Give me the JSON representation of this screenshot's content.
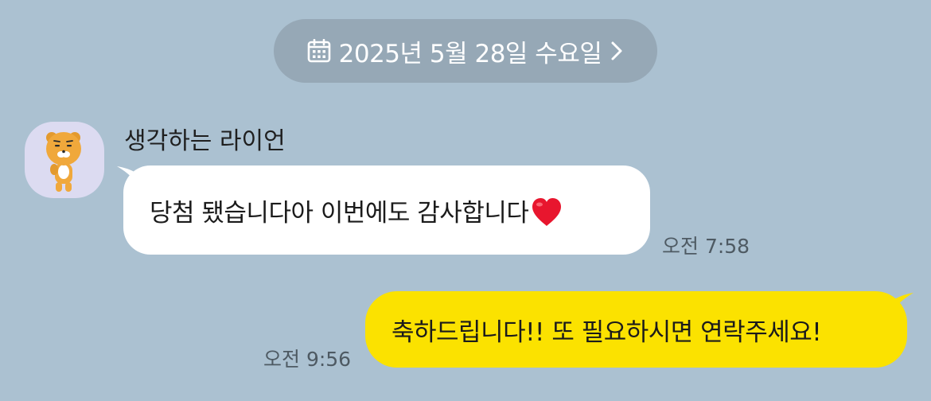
{
  "date_divider": {
    "text": "2025년 5월 28일 수요일",
    "icon": "calendar-icon",
    "chevron_icon": "chevron-right-icon"
  },
  "messages": [
    {
      "direction": "incoming",
      "sender": "생각하는 라이언",
      "avatar_icon": "lion-character-avatar",
      "text": "당첨 됐습니다아 이번에도 감사합니다",
      "emoji": "heart-icon",
      "time": "오전 7:58"
    },
    {
      "direction": "outgoing",
      "text": "축하드립니다!! 또 필요하시면 연락주세요!",
      "time": "오전 9:56"
    }
  ],
  "colors": {
    "background": "#abc1d1",
    "date_pill": "#96a8b6",
    "incoming_bubble": "#ffffff",
    "outgoing_bubble": "#fbe200",
    "avatar_bg": "#dcdbf1",
    "heart": "#e8162e"
  }
}
